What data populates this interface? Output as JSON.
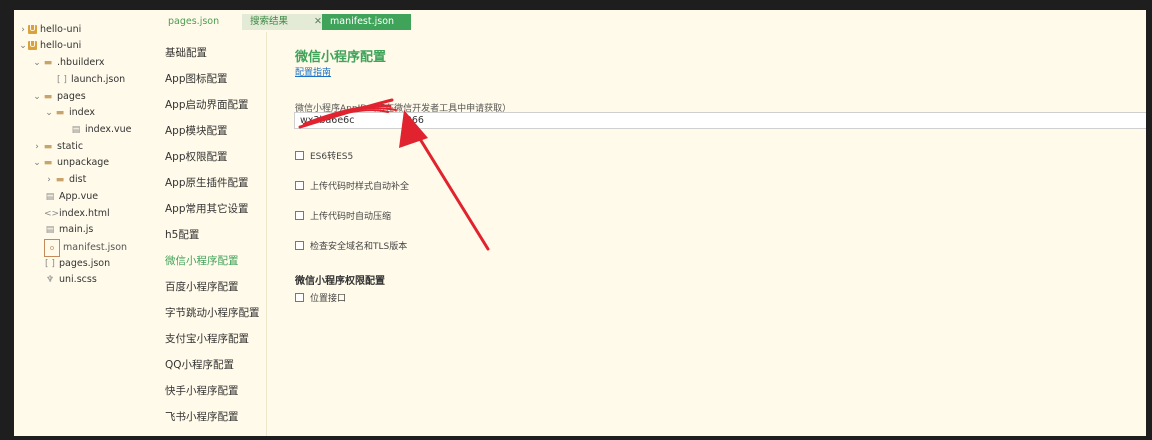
{
  "tree": {
    "items": [
      {
        "label": "hello-uni",
        "chevron": ">",
        "icon": "U",
        "icon_name": "uni-project-icon"
      },
      {
        "label": "hello-uni",
        "chevron": "v",
        "icon": "U",
        "icon_name": "uni-project-icon"
      },
      {
        "label": ".hbuilderx",
        "chevron": "v",
        "icon": "▬",
        "icon_name": "folder-icon"
      },
      {
        "label": "launch.json",
        "chevron": "",
        "icon": "[ ]",
        "icon_name": "json-file-icon"
      },
      {
        "label": "pages",
        "chevron": "v",
        "icon": "▬",
        "icon_name": "folder-icon"
      },
      {
        "label": "index",
        "chevron": "v",
        "icon": "▬",
        "icon_name": "folder-icon"
      },
      {
        "label": "index.vue",
        "chevron": "",
        "icon": "▤",
        "icon_name": "vue-file-icon"
      },
      {
        "label": "static",
        "chevron": ">",
        "icon": "▬",
        "icon_name": "folder-icon"
      },
      {
        "label": "unpackage",
        "chevron": "v",
        "icon": "▬",
        "icon_name": "folder-icon"
      },
      {
        "label": "dist",
        "chevron": ">",
        "icon": "▬",
        "icon_name": "folder-icon"
      },
      {
        "label": "App.vue",
        "chevron": "",
        "icon": "▤",
        "icon_name": "vue-file-icon"
      },
      {
        "label": "index.html",
        "chevron": "",
        "icon": "<>",
        "icon_name": "html-file-icon"
      },
      {
        "label": "main.js",
        "chevron": "",
        "icon": "▤",
        "icon_name": "js-file-icon"
      },
      {
        "label": "manifest.json",
        "chevron": "",
        "icon": "{o}",
        "icon_name": "manifest-file-icon"
      },
      {
        "label": "pages.json",
        "chevron": "",
        "icon": "[ ]",
        "icon_name": "json-file-icon"
      },
      {
        "label": "uni.scss",
        "chevron": "",
        "icon": "♆",
        "icon_name": "scss-file-icon"
      }
    ]
  },
  "tabs": [
    {
      "label": "pages.json"
    },
    {
      "label": "搜索结果",
      "close": "✕"
    },
    {
      "label": "manifest.json"
    }
  ],
  "menu": {
    "items": [
      {
        "label": "基础配置"
      },
      {
        "label": "App图标配置"
      },
      {
        "label": "App启动界面配置"
      },
      {
        "label": "App模块配置"
      },
      {
        "label": "App权限配置"
      },
      {
        "label": "App原生插件配置"
      },
      {
        "label": "App常用其它设置"
      },
      {
        "label": "h5配置"
      },
      {
        "label": "微信小程序配置"
      },
      {
        "label": "百度小程序配置"
      },
      {
        "label": "字节跳动小程序配置"
      },
      {
        "label": "支付宝小程序配置"
      },
      {
        "label": "QQ小程序配置"
      },
      {
        "label": "快手小程序配置"
      },
      {
        "label": "飞书小程序配置"
      }
    ],
    "active_index": 8
  },
  "main": {
    "title": "微信小程序配置",
    "guide_link": "配置指南",
    "appid_label": "微信小程序AppID（请在微信开发者工具中申请获取）",
    "appid_value": "wx3ba6e6c                 066",
    "options": [
      {
        "label": "ES6转ES5"
      },
      {
        "label": "上传代码时样式自动补全"
      },
      {
        "label": "上传代码时自动压缩"
      },
      {
        "label": "检查安全域名和TLS版本"
      }
    ],
    "section_title": "微信小程序权限配置",
    "permission_options": [
      {
        "label": "位置接口"
      }
    ]
  },
  "colors": {
    "accent": "#3fa35a",
    "annotation": "#e0232e",
    "background": "#fffae9"
  }
}
